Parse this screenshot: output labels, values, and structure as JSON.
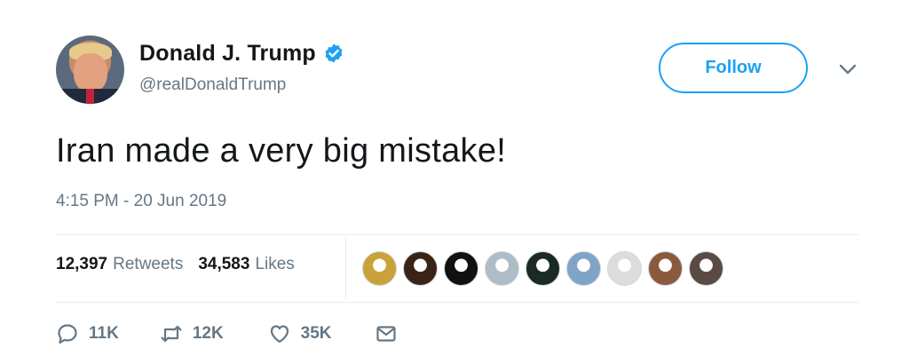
{
  "author": {
    "display_name": "Donald J. Trump",
    "handle": "@realDonaldTrump",
    "verified": true,
    "avatar_icon": "profile-photo"
  },
  "follow_label": "Follow",
  "more_icon": "chevron-down-icon",
  "tweet_text": "Iran made a very big mistake!",
  "timestamp": "4:15 PM - 20 Jun 2019",
  "stats": {
    "retweets_count": "12,397",
    "retweets_label": "Retweets",
    "likes_count": "34,583",
    "likes_label": "Likes"
  },
  "likers": [
    {
      "color": "#c9a23a"
    },
    {
      "color": "#3a2418"
    },
    {
      "color": "#111111"
    },
    {
      "color": "#aebcc8"
    },
    {
      "color": "#1b2a22"
    },
    {
      "color": "#7fa4c6"
    },
    {
      "color": "#dcdcdc"
    },
    {
      "color": "#8a5a3c"
    },
    {
      "color": "#5a4a42"
    }
  ],
  "actions": {
    "reply_count": "11K",
    "retweet_count": "12K",
    "like_count": "35K"
  },
  "colors": {
    "accent": "#1da1f2",
    "secondary_text": "#657786",
    "primary_text": "#14171a"
  }
}
